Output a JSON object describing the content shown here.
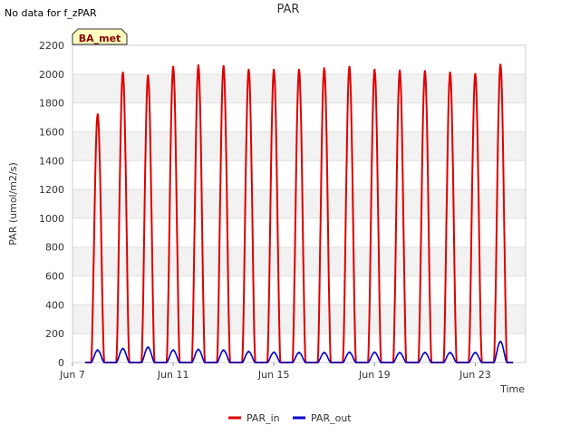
{
  "chart_data": {
    "type": "line",
    "title": "PAR",
    "note": "No data for f_zPAR",
    "badge": "BA_met",
    "xlabel": "Time",
    "ylabel": "PAR (umol/m2/s)",
    "ylim": [
      0,
      2200
    ],
    "yticks": [
      0,
      200,
      400,
      600,
      800,
      1000,
      1200,
      1400,
      1600,
      1800,
      2000,
      2200
    ],
    "xlim_day": [
      7,
      25
    ],
    "xticks": [
      {
        "day": 7,
        "label": "Jun 7"
      },
      {
        "day": 11,
        "label": "Jun 11"
      },
      {
        "day": 15,
        "label": "Jun 15"
      },
      {
        "day": 19,
        "label": "Jun 19"
      },
      {
        "day": 23,
        "label": "Jun 23"
      }
    ],
    "grid": true,
    "legend_position": "bottom",
    "series": [
      {
        "name": "PAR_in",
        "color": "#dd0000",
        "daily_peak": [
          1720,
          2010,
          1990,
          2050,
          2060,
          2055,
          2030,
          2030,
          2030,
          2040,
          2050,
          2030,
          2025,
          2020,
          2010,
          2000,
          2065
        ]
      },
      {
        "name": "PAR_out",
        "color": "#0000cc",
        "daily_peak": [
          85,
          95,
          105,
          85,
          90,
          85,
          75,
          70,
          68,
          68,
          70,
          70,
          68,
          68,
          68,
          68,
          145
        ]
      }
    ]
  }
}
